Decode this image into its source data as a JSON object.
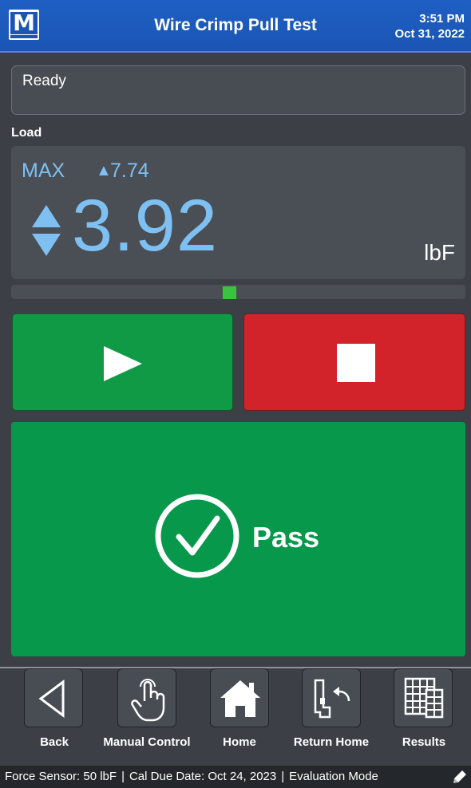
{
  "header": {
    "logo_letter": "M",
    "title": "Wire Crimp Pull Test",
    "time": "3:51 PM",
    "date": "Oct 31, 2022"
  },
  "status": {
    "text": "Ready"
  },
  "load": {
    "label": "Load",
    "max_label": "MAX",
    "max_value": "7.74",
    "value": "3.92",
    "unit": "lbF",
    "indicator_position_fraction": 0.48
  },
  "buttons": {
    "start_icon": "play-icon",
    "stop_icon": "stop-icon"
  },
  "result": {
    "text": "Pass",
    "icon": "check-circle-icon"
  },
  "nav": [
    {
      "label": "Back",
      "icon": "back-triangle-icon"
    },
    {
      "label": "Manual Control",
      "icon": "hand-pointer-icon"
    },
    {
      "label": "Home",
      "icon": "home-icon"
    },
    {
      "label": "Return Home",
      "icon": "return-home-icon"
    },
    {
      "label": "Results",
      "icon": "results-grid-icon"
    }
  ],
  "footer": {
    "sensor": "Force Sensor: 50 lbF",
    "cal_due": "Cal Due Date: Oct 24, 2023",
    "mode": "Evaluation Mode",
    "separator": "|"
  },
  "colors": {
    "header_blue": "#1a55b3",
    "value_blue": "#7ec0f2",
    "start_green": "#119a45",
    "stop_red": "#d3232a",
    "pass_green": "#07984b",
    "indicator_green": "#39c33f"
  }
}
